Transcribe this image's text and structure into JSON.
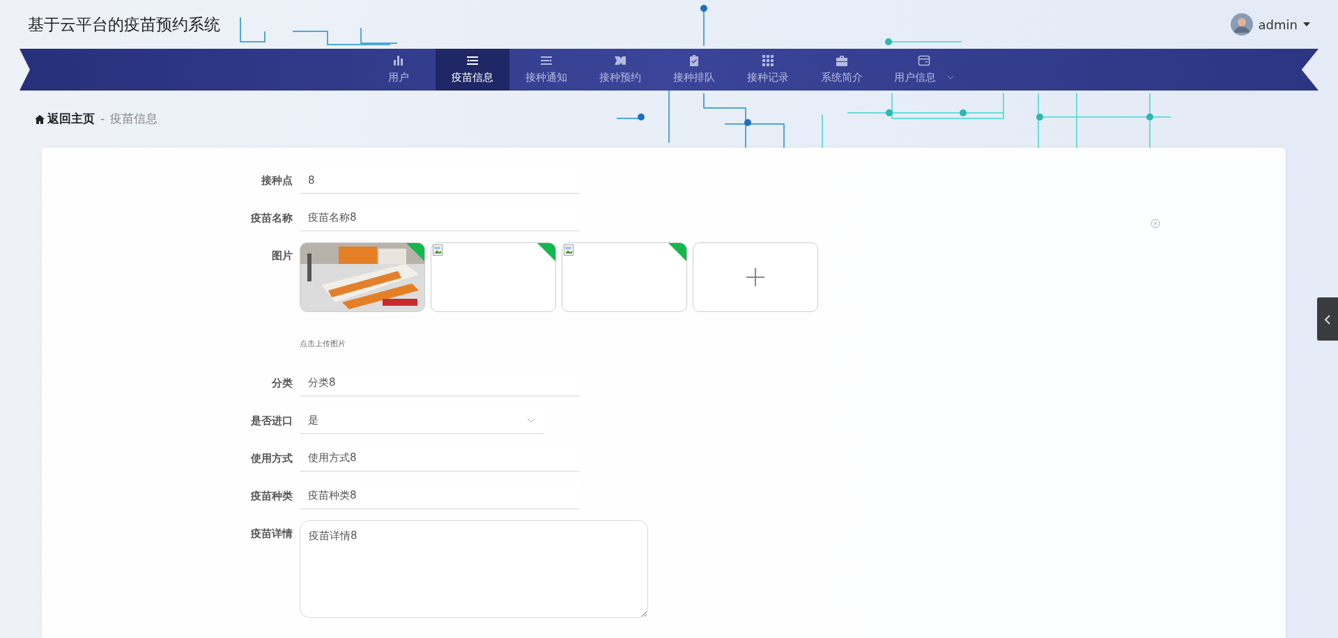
{
  "header": {
    "title": "基于云平台的疫苗预约系统",
    "user": "admin"
  },
  "nav": [
    {
      "label": "用户",
      "selected": false,
      "dropdown": false
    },
    {
      "label": "疫苗信息",
      "selected": true,
      "dropdown": false
    },
    {
      "label": "接种通知",
      "selected": false,
      "dropdown": false
    },
    {
      "label": "接种预约",
      "selected": false,
      "dropdown": false
    },
    {
      "label": "接种排队",
      "selected": false,
      "dropdown": false
    },
    {
      "label": "接种记录",
      "selected": false,
      "dropdown": false
    },
    {
      "label": "系统简介",
      "selected": false,
      "dropdown": false
    },
    {
      "label": "用户信息",
      "selected": false,
      "dropdown": true
    }
  ],
  "breadcrumb": {
    "home": "返回主页",
    "separator": "-",
    "current": "疫苗信息"
  },
  "form": [
    {
      "kind": "input",
      "label": "接种点",
      "value": "8"
    },
    {
      "kind": "input",
      "label": "疫苗名称",
      "value": "疫苗名称8"
    },
    {
      "kind": "images",
      "label": "图片",
      "images": [
        {
          "kind": "picture"
        },
        {
          "kind": "broken"
        },
        {
          "kind": "broken"
        }
      ],
      "hint": "点击上传图片"
    },
    {
      "kind": "input",
      "label": "分类",
      "value": "分类8"
    },
    {
      "kind": "select",
      "label": "是否进口",
      "value": "是"
    },
    {
      "kind": "input",
      "label": "使用方式",
      "value": "使用方式8"
    },
    {
      "kind": "input",
      "label": "疫苗种类",
      "value": "疫苗种类8"
    },
    {
      "kind": "textarea",
      "label": "疫苗详情",
      "value": "疫苗详情8"
    }
  ]
}
